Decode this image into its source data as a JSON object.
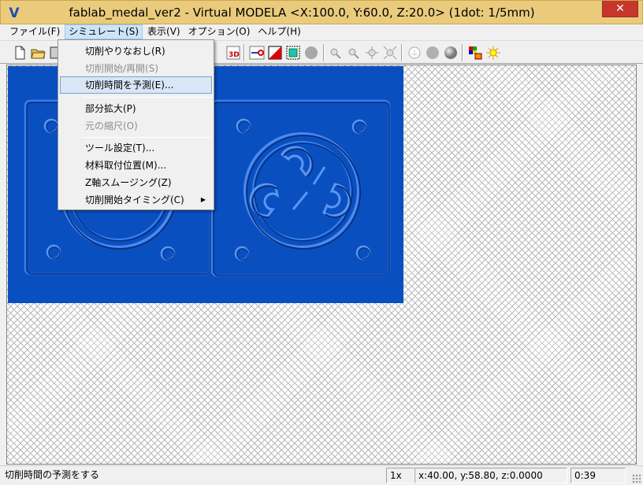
{
  "window": {
    "title": "fablab_medal_ver2 - Virtual MODELA <X:100.0, Y:60.0, Z:20.0> (1dot: 1/5mm)",
    "app_icon": "V",
    "close_glyph": "✕"
  },
  "menubar": {
    "items": [
      {
        "label": "ファイル(F)"
      },
      {
        "label": "シミュレート(S)"
      },
      {
        "label": "表示(V)"
      },
      {
        "label": "オプション(O)"
      },
      {
        "label": "ヘルプ(H)"
      }
    ]
  },
  "toolbar": {
    "buttons": [
      "new-file-icon",
      "open-folder-icon",
      "stop-icon",
      "view-3d-icon",
      "path-preview-icon",
      "material-icon",
      "fill-rect-icon",
      "gray-sphere-icon",
      "zoom-tool-icon",
      "move-tool-icon",
      "rotate-tool-icon",
      "fit-tool-icon",
      "circle-outline-icon",
      "circle-gray-icon",
      "sphere-icon",
      "palette-icon",
      "light-icon"
    ]
  },
  "dropdown": {
    "items": [
      {
        "label": "切削やりなおし(R)",
        "disabled": false
      },
      {
        "label": "切削開始/再開(S)",
        "disabled": true
      },
      {
        "label": "切削時間を予測(E)...",
        "disabled": false,
        "highlighted": true
      },
      {
        "label": "部分拡大(P)",
        "disabled": false
      },
      {
        "label": "元の縮尺(O)",
        "disabled": true
      },
      {
        "label": "ツール設定(T)...",
        "disabled": false
      },
      {
        "label": "材料取付位置(M)...",
        "disabled": false
      },
      {
        "label": "Z軸スムージング(Z)",
        "disabled": false
      },
      {
        "label": "切削開始タイミング(C)",
        "disabled": false,
        "submenu": true
      }
    ],
    "submenu_arrow": "▶"
  },
  "statusbar": {
    "message": "切削時間の予測をする",
    "zoom": "1x",
    "coords": "x:40.00, y:58.80, z:0.0000",
    "time": "0:39"
  },
  "colors": {
    "titlebar": "#eacb7c",
    "model_blue": "#0a4fc0",
    "highlight": "#d8e6f5"
  }
}
